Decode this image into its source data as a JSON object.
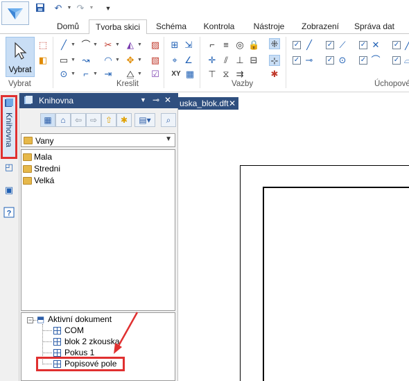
{
  "quick_access": {
    "undo_icon": "undo-icon",
    "redo_icon": "redo-icon",
    "save_icon": "save-icon",
    "customize_icon": "customize-qat-icon"
  },
  "tabs": [
    {
      "label": "Domů"
    },
    {
      "label": "Tvorba skici",
      "active": true
    },
    {
      "label": "Schéma"
    },
    {
      "label": "Kontrola"
    },
    {
      "label": "Nástroje"
    },
    {
      "label": "Zobrazení"
    },
    {
      "label": "Správa dat"
    }
  ],
  "ribbon": {
    "select_button": "Vybrat",
    "groups": {
      "select": "Vybrat",
      "draw": "Kreslit",
      "relations": "Vazby",
      "handles": "Úchopové"
    },
    "relation_xy_label": "XY"
  },
  "library_panel": {
    "title": "Knihovna",
    "vertical_tab": "Knihovna",
    "folder_combo_value": "Vany",
    "folders": [
      {
        "label": "Mala"
      },
      {
        "label": "Stredni"
      },
      {
        "label": "Velká"
      }
    ],
    "tree_root": "Aktivní dokument",
    "tree_items": [
      {
        "label": "COM"
      },
      {
        "label": "blok 2 zkouska"
      },
      {
        "label": "Pokus 1"
      },
      {
        "label": "Popisové pole"
      }
    ]
  },
  "document_tab": {
    "label": "uska_blok.dft",
    "close": "✕"
  },
  "colors": {
    "panel_header": "#2f4f7f",
    "highlight_red": "#e03030",
    "ribbon_selected": "#c9def5"
  }
}
